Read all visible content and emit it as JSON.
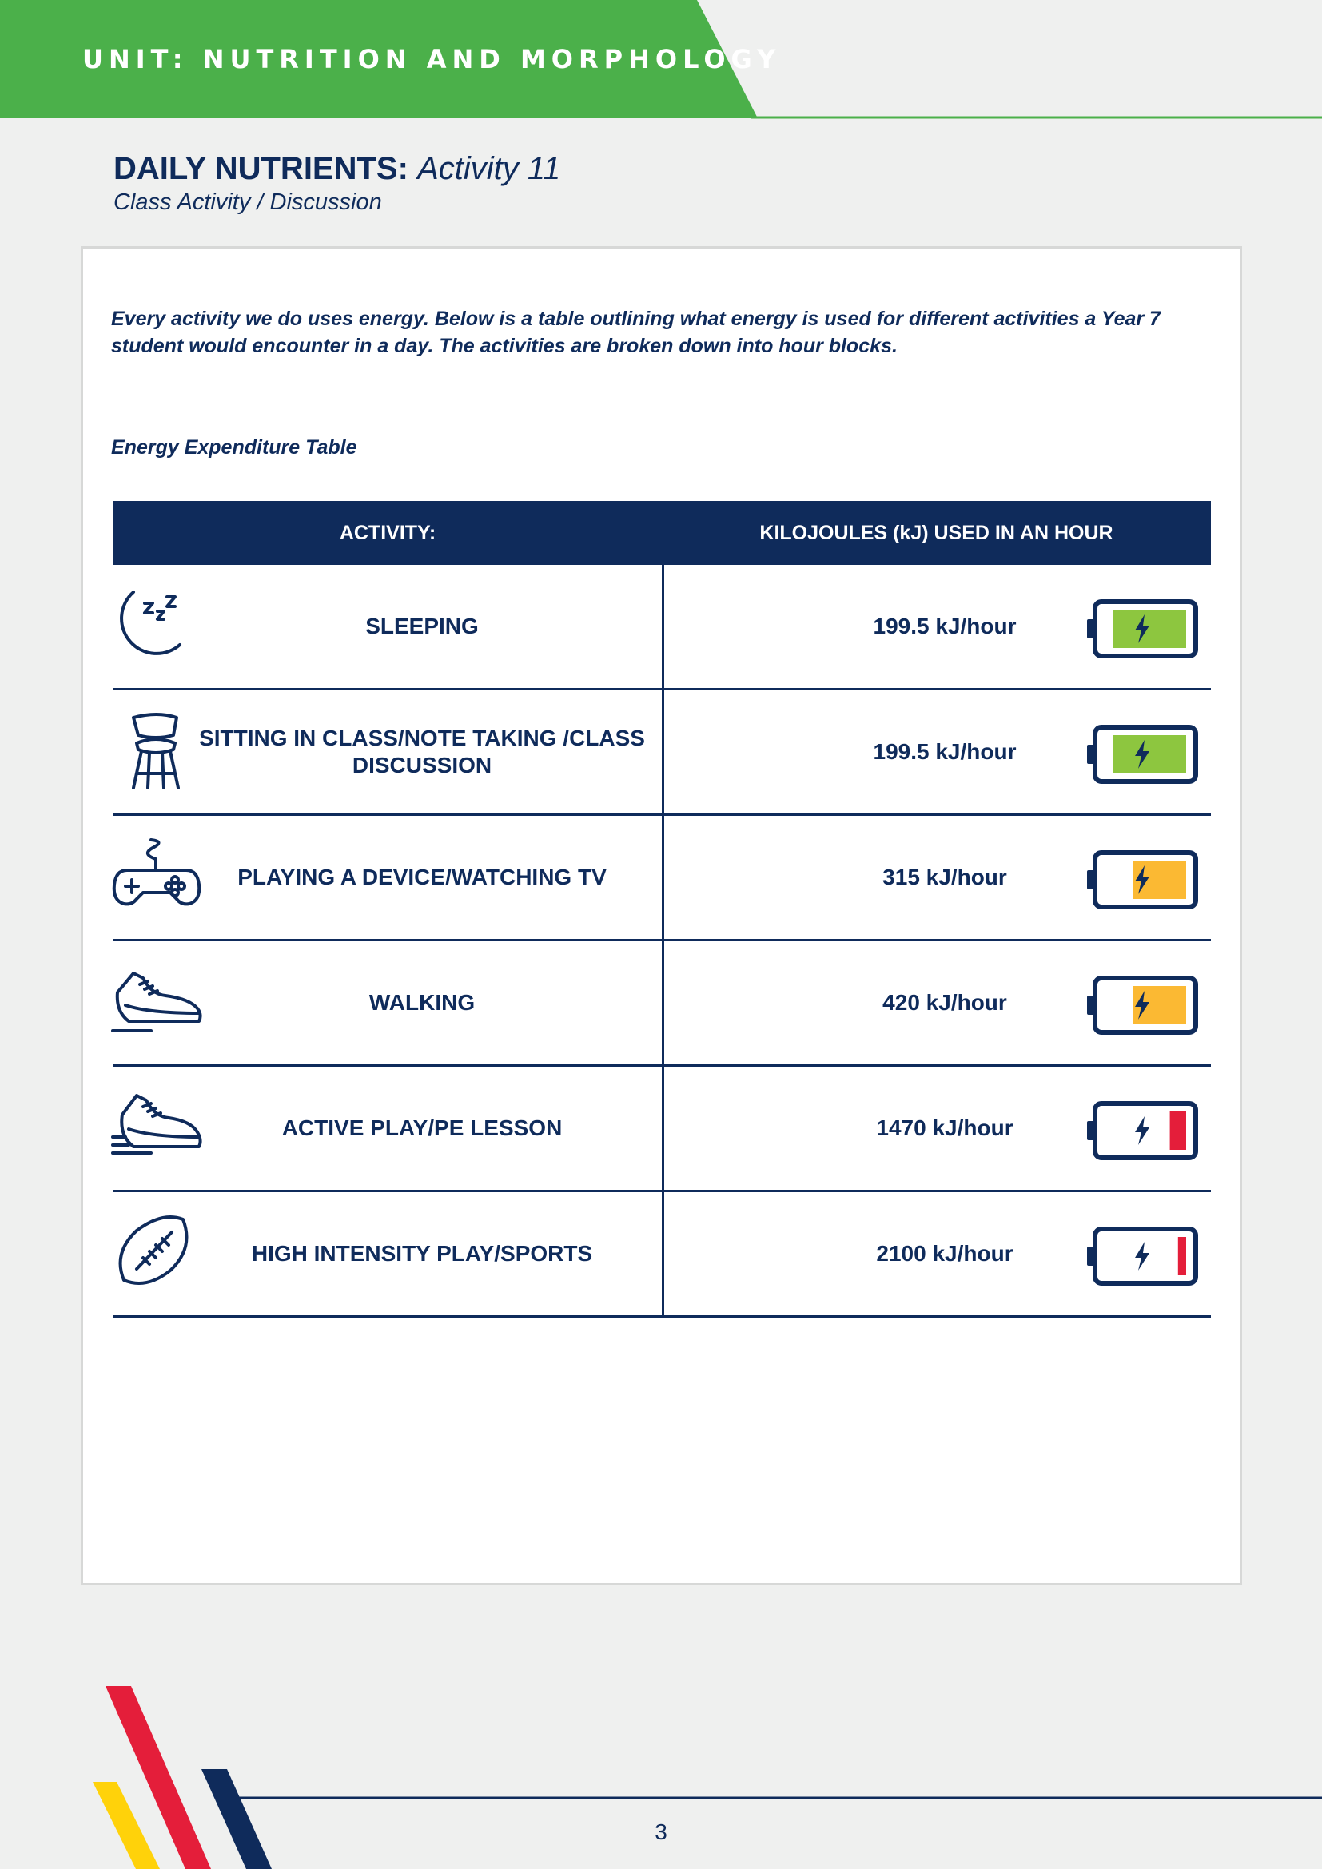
{
  "header": {
    "unit_title": "UNIT: NUTRITION AND MORPHOLOGY"
  },
  "heading": {
    "title_bold": "DAILY NUTRIENTS:",
    "title_italic": "Activity 11",
    "subtitle": "Class Activity / Discussion"
  },
  "intro": "Every activity we do uses energy. Below is a table outlining what energy is used for different activities a Year 7 student would encounter in a day. The activities are broken down into hour blocks.",
  "table": {
    "caption": "Energy Expenditure Table",
    "headers": [
      "ACTIVITY:",
      "KILOJOULES (kJ) USED IN AN HOUR"
    ],
    "rows": [
      {
        "icon": "sleeping-moon-icon",
        "activity": "SLEEPING",
        "energy": "199.5 kJ/hour",
        "battery_level": 0.9,
        "battery_color": "#8dc63f"
      },
      {
        "icon": "chair-icon",
        "activity": "SITTING IN CLASS/NOTE TAKING /CLASS DISCUSSION",
        "energy": "199.5 kJ/hour",
        "battery_level": 0.9,
        "battery_color": "#8dc63f"
      },
      {
        "icon": "game-controller-icon",
        "activity": "PLAYING A DEVICE/WATCHING TV",
        "energy": "315 kJ/hour",
        "battery_level": 0.65,
        "battery_color": "#fbb933"
      },
      {
        "icon": "sneaker-icon",
        "activity": "WALKING",
        "energy": "420 kJ/hour",
        "battery_level": 0.65,
        "battery_color": "#fbb933"
      },
      {
        "icon": "running-shoe-icon",
        "activity": "ACTIVE PLAY/PE LESSON",
        "energy": "1470 kJ/hour",
        "battery_level": 0.2,
        "battery_color": "#e41e3a"
      },
      {
        "icon": "football-icon",
        "activity": "HIGH INTENSITY PLAY/SPORTS",
        "energy": "2100 kJ/hour",
        "battery_level": 0.1,
        "battery_color": "#e41e3a"
      }
    ]
  },
  "footer": {
    "page_number": "3"
  },
  "colors": {
    "navy": "#0f2b5b",
    "green": "#4bb04a",
    "red": "#e41e3a",
    "yellow": "#ffd20a",
    "background": "#eff0ef"
  }
}
